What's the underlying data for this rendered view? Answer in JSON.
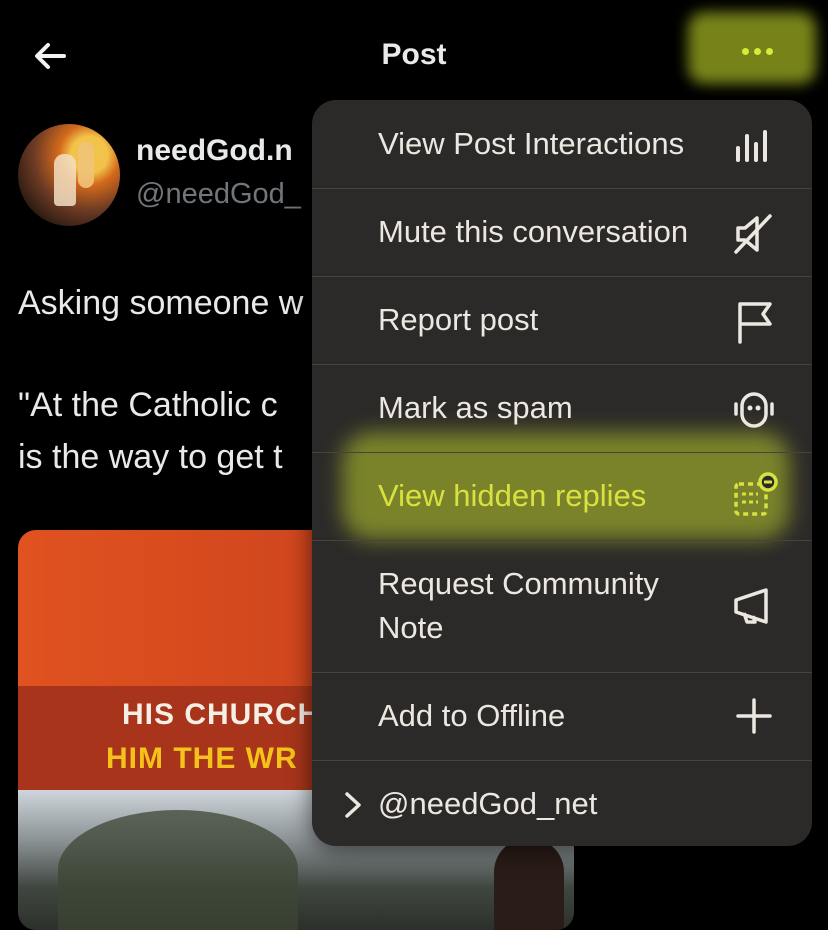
{
  "nav": {
    "title": "Post"
  },
  "post": {
    "name": "needGod.n",
    "handle": "@needGod_",
    "text_line1": "Asking someone w",
    "text_line2": "\"At the Catholic c",
    "text_line3": "is the way to get t",
    "image_text_line1": "HIS CHURCH",
    "image_text_line2": "HIM THE WR"
  },
  "menu": {
    "items": [
      {
        "label": "View Post Interactions",
        "icon": "bar-chart-icon"
      },
      {
        "label": "Mute this conversation",
        "icon": "mute-speaker-icon"
      },
      {
        "label": "Report post",
        "icon": "flag-icon"
      },
      {
        "label": "Mark as spam",
        "icon": "robot-icon"
      },
      {
        "label": "View hidden replies",
        "icon": "hidden-replies-icon"
      },
      {
        "label_line1": "Request Community",
        "label_line2": "Note",
        "icon": "megaphone-icon"
      },
      {
        "label": "Add to Offline",
        "icon": "plus-icon"
      },
      {
        "label": "@needGod_net",
        "icon": "chevron-right-icon"
      }
    ]
  },
  "colors": {
    "background": "#000000",
    "menu_background": "#2c2a28",
    "highlight": "#d9ef2e",
    "text": "#e7e9ea",
    "muted_text": "#71767b"
  }
}
